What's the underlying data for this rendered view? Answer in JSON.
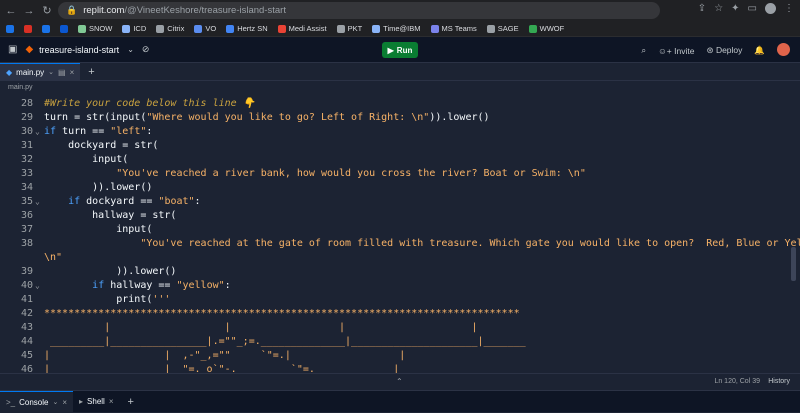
{
  "browser": {
    "url_host": "replit.com",
    "url_path": "/@VineetKeshore/treasure-island-start",
    "bookmarks": [
      {
        "label": "",
        "color": "#1a73e8"
      },
      {
        "label": "",
        "color": "#d93025"
      },
      {
        "label": "",
        "color": "#1a73e8"
      },
      {
        "label": "",
        "color": "#0b57d0"
      },
      {
        "label": "SNOW",
        "color": "#81c995"
      },
      {
        "label": "ICD",
        "color": "#8ab4f8"
      },
      {
        "label": "Citrix",
        "color": "#9aa0a6"
      },
      {
        "label": "VO",
        "color": "#5b8def"
      },
      {
        "label": "Hertz SN",
        "color": "#4285f4"
      },
      {
        "label": "Medi Assist",
        "color": "#ea4335"
      },
      {
        "label": "PKT",
        "color": "#9aa0a6"
      },
      {
        "label": "Time@IBM",
        "color": "#8ab4f8"
      },
      {
        "label": "MS Teams",
        "color": "#7b83eb"
      },
      {
        "label": "SAGE",
        "color": "#9aa0a6"
      },
      {
        "label": "WWOF",
        "color": "#34a853"
      }
    ]
  },
  "header": {
    "repl_name": "treasure-island-start",
    "run_label": "Run",
    "invite_label": "Invite",
    "deploy_label": "Deploy"
  },
  "tabs": {
    "file_tab": "main.py",
    "breadcrumb": "main.py"
  },
  "editor": {
    "lines": [
      {
        "n": "28",
        "fold": "",
        "html": "<span class='c'>#Write your code below this line 👇</span>"
      },
      {
        "n": "29",
        "fold": "",
        "html": "turn = str(input(<span class='s'>\"Where would you like to go? Left of Right: \\n\"</span>)).lower()"
      },
      {
        "n": "30",
        "fold": "⌄",
        "html": "<span class='k'>if</span> turn == <span class='s'>\"left\"</span>:"
      },
      {
        "n": "31",
        "fold": "",
        "html": "    dockyard = str("
      },
      {
        "n": "32",
        "fold": "",
        "html": "        input("
      },
      {
        "n": "33",
        "fold": "",
        "html": "            <span class='s'>\"You've reached a river bank, how would you cross the river? Boat or Swim: \\n\"</span>"
      },
      {
        "n": "34",
        "fold": "",
        "html": "        )).lower()"
      },
      {
        "n": "35",
        "fold": "⌄",
        "html": "    <span class='k'>if</span> dockyard == <span class='s'>\"boat\"</span>:"
      },
      {
        "n": "36",
        "fold": "",
        "html": "        hallway = str("
      },
      {
        "n": "37",
        "fold": "",
        "html": "            input("
      },
      {
        "n": "38",
        "fold": "",
        "html": "                <span class='s'>\"You've reached at the gate of room filled with treasure. Which gate you would like to open?  Red, Blue or Yellow:</span>"
      },
      {
        "n": "",
        "fold": "",
        "html": "<span class='s'>\\n\"</span>"
      },
      {
        "n": "39",
        "fold": "",
        "html": "            )).lower()"
      },
      {
        "n": "40",
        "fold": "⌄",
        "html": "        <span class='k'>if</span> hallway == <span class='s'>\"yellow\"</span>:"
      },
      {
        "n": "41",
        "fold": "",
        "html": "            print(<span class='s'>'''</span>"
      },
      {
        "n": "42",
        "fold": "",
        "html": "<span class='s'>*******************************************************************************</span>"
      },
      {
        "n": "43",
        "fold": "",
        "html": "<span class='s'>          |                   |                  |                     |</span>"
      },
      {
        "n": "44",
        "fold": "",
        "html": "<span class='s'> _________|________________|.=\"\"_;=.______________|_____________________|_______</span>"
      },
      {
        "n": "45",
        "fold": "",
        "html": "<span class='s'>|                   |  ,-\"_,=\"\"     `\"=.|                  |</span>"
      },
      {
        "n": "46",
        "fold": "",
        "html": "<span class='s'>|                   |  \"=._o`\"-._        `\"=.             |</span>"
      }
    ]
  },
  "status": {
    "position": "Ln 120, Col 39",
    "history_label": "History"
  },
  "bottom": {
    "console_label": "Console",
    "shell_label": "Shell"
  }
}
